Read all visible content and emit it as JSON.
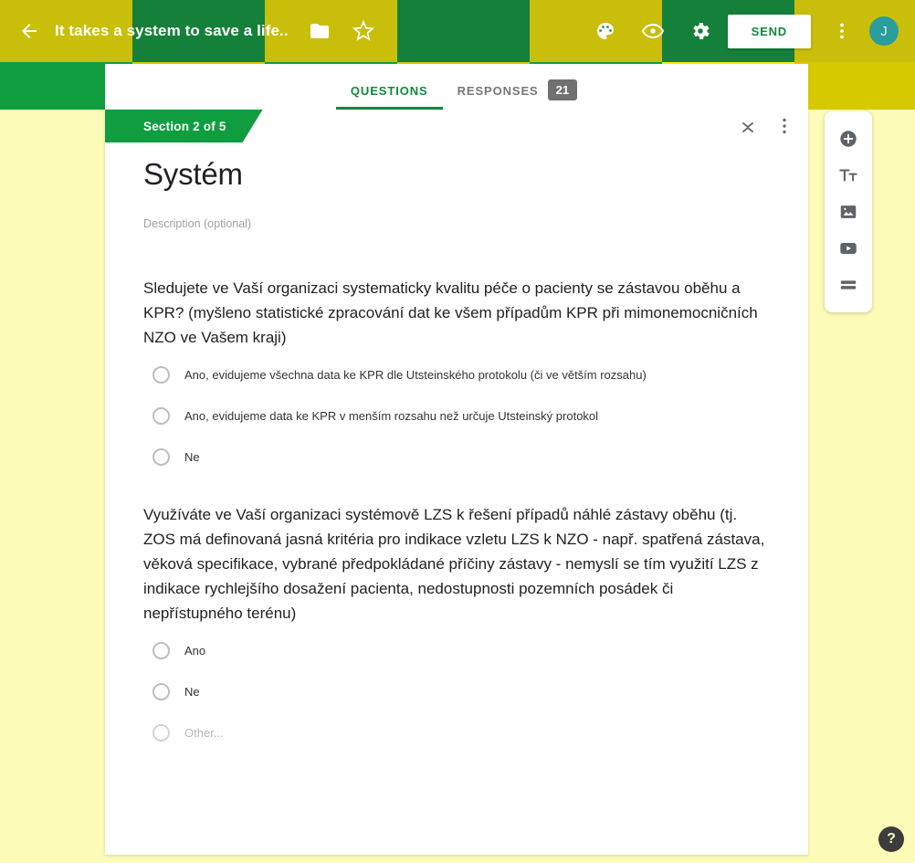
{
  "topbar": {
    "back_icon": "back-arrow-icon",
    "title": "It takes a system to save a life..",
    "folder_icon": "folder-icon",
    "star_icon": "star-icon",
    "palette_icon": "palette-icon",
    "preview_icon": "eye-icon",
    "settings_icon": "gear-icon",
    "send_label": "SEND",
    "more_icon": "more-vert-icon",
    "avatar_initial": "J"
  },
  "tabs": [
    {
      "label": "QUESTIONS",
      "active": true
    },
    {
      "label": "RESPONSES",
      "active": false
    }
  ],
  "responses_count": "21",
  "card": {
    "section_label": "Section 2 of 5",
    "collapse_icon": "collapse-icon",
    "more_icon": "more-vert-icon",
    "title": "Systém",
    "description_placeholder": "Description (optional)"
  },
  "questions": [
    {
      "text": "Sledujete ve Vaší organizaci systematicky kvalitu péče o pacienty se zástavou oběhu a KPR? (myšleno statistické zpracování dat ke všem případům KPR při mimonemocničních NZO ve Vašem kraji)",
      "options": [
        {
          "label": "Ano, evidujeme všechna data ke KPR dle Utsteinského protokolu (či ve větším rozsahu)",
          "placeholder": false
        },
        {
          "label": "Ano, evidujeme data ke KPR v menším rozsahu než určuje Utsteinský protokol",
          "placeholder": false
        },
        {
          "label": "Ne",
          "placeholder": false
        }
      ]
    },
    {
      "text": "Využíváte ve Vaší organizaci systémově LZS k řešení případů náhlé zástavy oběhu (tj. ZOS má definovaná jasná kritéria pro indikace vzletu LZS k NZO - např. spatřená zástava, věková specifikace, vybrané předpokládané příčiny zástavy - nemyslí se tím využití LZS z indikace rychlejšího dosažení pacienta, nedostupnosti pozemních posádek či nepřístupného terénu)",
      "options": [
        {
          "label": "Ano",
          "placeholder": false
        },
        {
          "label": "Ne",
          "placeholder": false
        },
        {
          "label": "Other...",
          "placeholder": true
        }
      ]
    }
  ],
  "right_rail": [
    {
      "icon": "add-question-icon"
    },
    {
      "icon": "add-title-icon"
    },
    {
      "icon": "add-image-icon"
    },
    {
      "icon": "add-video-icon"
    },
    {
      "icon": "add-section-icon"
    }
  ],
  "help": {
    "label": "?"
  },
  "colors": {
    "banner_green": "#15803a",
    "banner_green_light": "#0f9d3f",
    "banner_olive": "#c9be0a",
    "banner_yellow": "#d6c900",
    "page_background": "#FCFCB8",
    "accent": "#0f8a3c",
    "badge": "#707070"
  }
}
